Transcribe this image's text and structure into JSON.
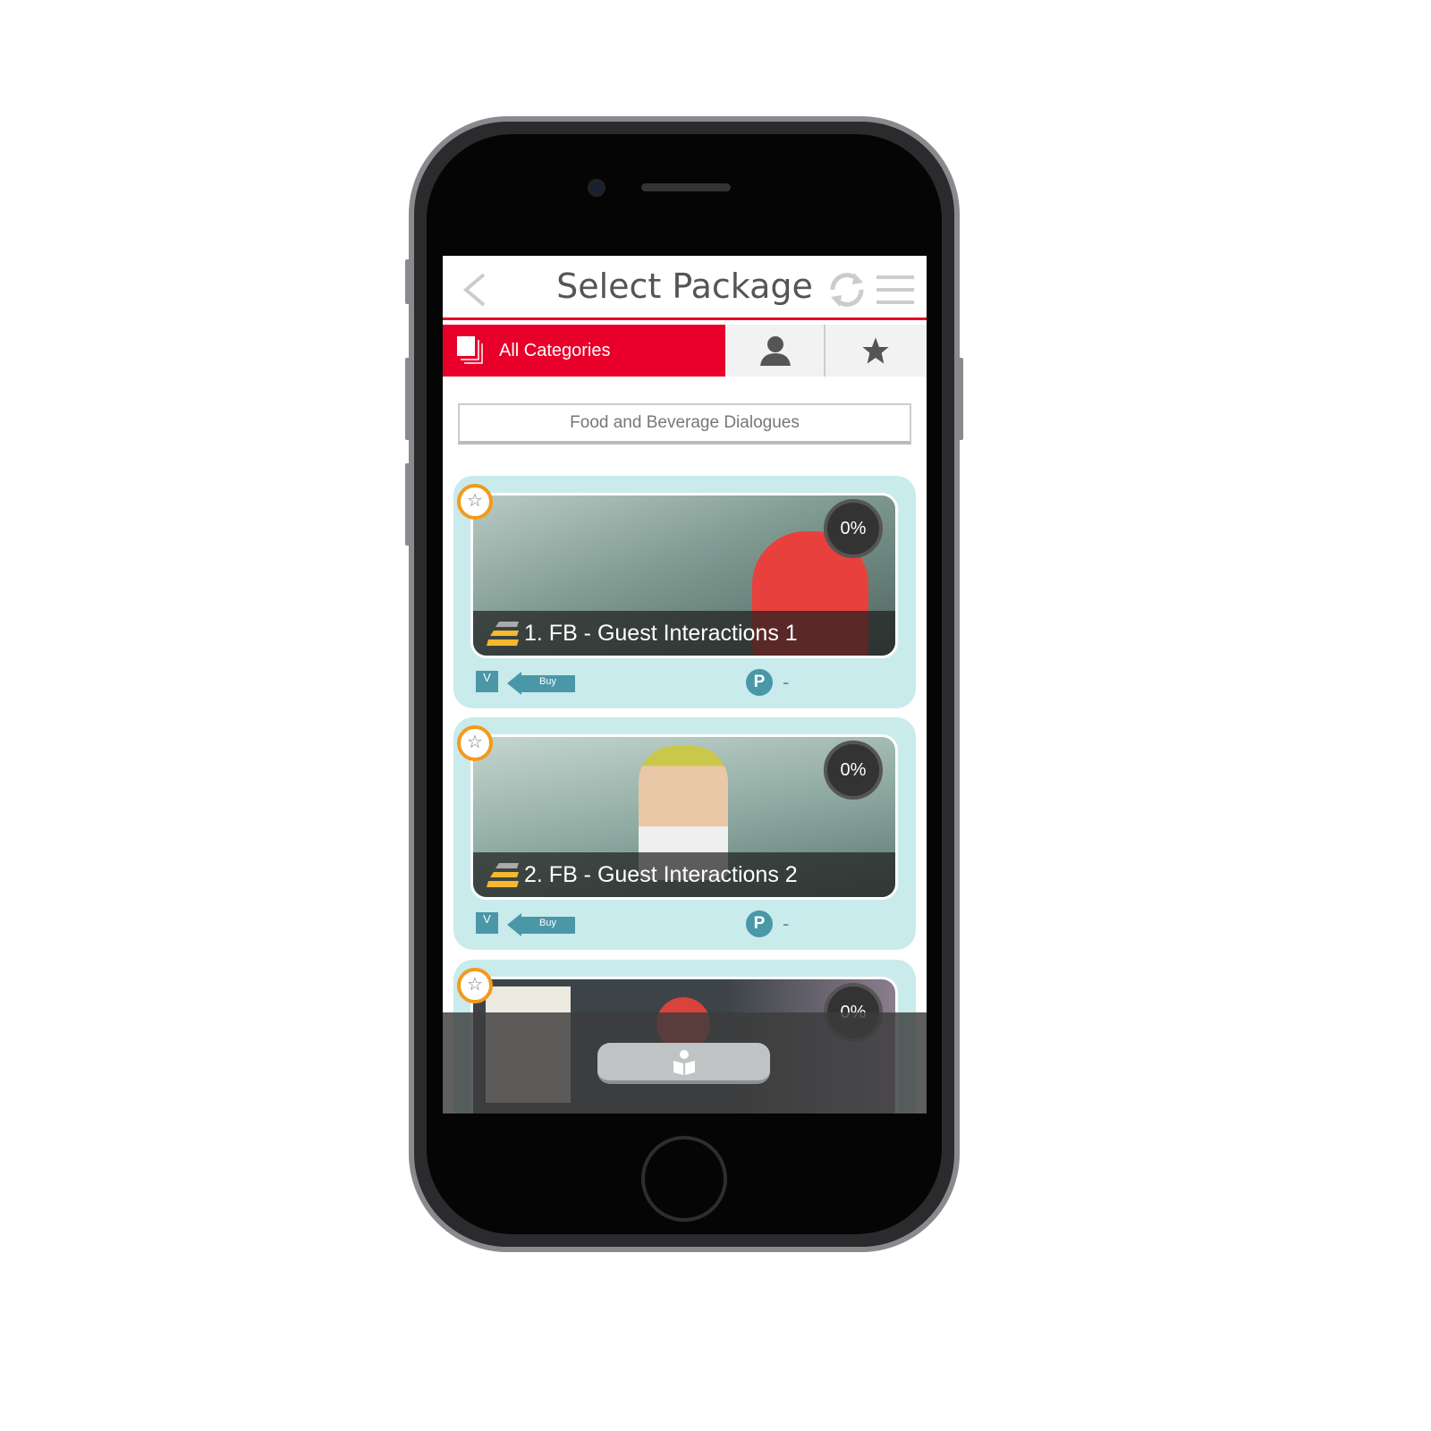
{
  "header": {
    "title": "Select Package"
  },
  "tabs": {
    "all_categories": "All Categories"
  },
  "category": {
    "value": "Food and Beverage Dialogues"
  },
  "packages": [
    {
      "title": "1. FB - Guest Interactions 1",
      "progress": "0%",
      "buy": "Buy",
      "v": "V",
      "points_badge": "P",
      "points": "-"
    },
    {
      "title": "2. FB - Guest Interactions 2",
      "progress": "0%",
      "buy": "Buy",
      "v": "V",
      "points_badge": "P",
      "points": "-"
    },
    {
      "progress": "0%"
    }
  ],
  "colors": {
    "accent": "#e8002a",
    "card": "#c9ebec",
    "teal": "#4a97a8",
    "favorite": "#f39a1b"
  }
}
